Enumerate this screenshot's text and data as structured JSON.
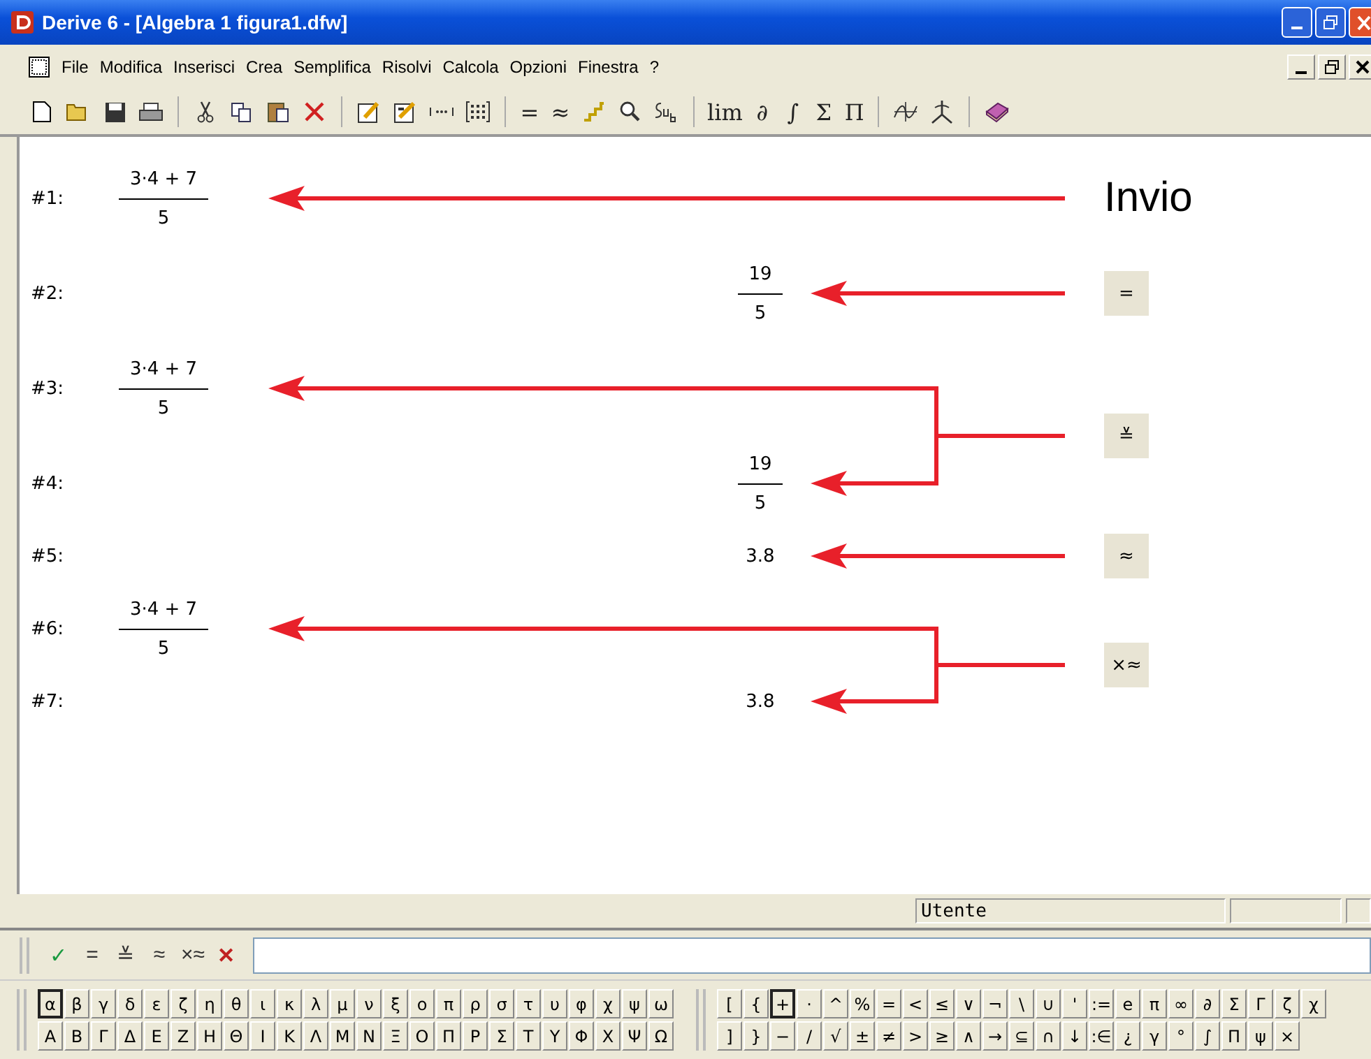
{
  "window": {
    "title": "Derive 6 - [Algebra 1  figura1.dfw]"
  },
  "menu": [
    "File",
    "Modifica",
    "Inserisci",
    "Crea",
    "Semplifica",
    "Risolvi",
    "Calcola",
    "Opzioni",
    "Finestra",
    "?"
  ],
  "toolbar": [
    [
      {
        "kind": "new"
      },
      {
        "kind": "open"
      },
      {
        "kind": "save"
      },
      {
        "kind": "print"
      }
    ],
    [
      {
        "kind": "cut"
      },
      {
        "kind": "copy"
      },
      {
        "kind": "paste"
      },
      {
        "kind": "delete"
      }
    ],
    [
      {
        "kind": "author"
      },
      {
        "kind": "edit"
      },
      {
        "kind": "vector"
      },
      {
        "kind": "matrix"
      }
    ],
    [
      {
        "kind": "symbol",
        "text": "="
      },
      {
        "kind": "symbol",
        "text": "≈"
      },
      {
        "kind": "steps"
      },
      {
        "kind": "zoom"
      },
      {
        "kind": "sub"
      }
    ],
    [
      {
        "kind": "symbol",
        "text": "lim"
      },
      {
        "kind": "symbol",
        "text": "∂"
      },
      {
        "kind": "symbol",
        "text": "∫"
      },
      {
        "kind": "symbol",
        "text": "Σ"
      },
      {
        "kind": "symbol",
        "text": "Π"
      }
    ],
    [
      {
        "kind": "plot2d"
      },
      {
        "kind": "plot3d"
      }
    ],
    [
      {
        "kind": "book"
      }
    ]
  ],
  "steps": [
    {
      "key": {
        "kind": "text",
        "label": "Invio"
      },
      "expressions": [
        {
          "label": "#1:",
          "kind": "input",
          "numerator": "3·4 + 7",
          "denominator": "5"
        }
      ]
    },
    {
      "key": {
        "kind": "key",
        "label": "="
      },
      "expressions": [
        {
          "label": "#2:",
          "kind": "result",
          "numerator": "19",
          "denominator": "5"
        }
      ]
    },
    {
      "key": {
        "kind": "key",
        "label": "≚"
      },
      "expressions": [
        {
          "label": "#3:",
          "kind": "input",
          "numerator": "3·4 + 7",
          "denominator": "5"
        },
        {
          "label": "#4:",
          "kind": "result",
          "numerator": "19",
          "denominator": "5"
        }
      ]
    },
    {
      "key": {
        "kind": "key",
        "label": "≈"
      },
      "expressions": [
        {
          "label": "#5:",
          "kind": "result",
          "value": "3.8"
        }
      ]
    },
    {
      "key": {
        "kind": "key",
        "label": "×≈"
      },
      "expressions": [
        {
          "label": "#6:",
          "kind": "input",
          "numerator": "3·4 + 7",
          "denominator": "5"
        },
        {
          "label": "#7:",
          "kind": "result",
          "value": "3.8"
        }
      ]
    }
  ],
  "status_bar": {
    "mode": "Utente"
  },
  "entry_bar": {
    "buttons": [
      {
        "text": "✓",
        "kind": "accept"
      },
      {
        "text": "=",
        "kind": "plain"
      },
      {
        "text": "≚",
        "kind": "plain"
      },
      {
        "text": "≈",
        "kind": "plain"
      },
      {
        "text": "×≈",
        "kind": "plain"
      },
      {
        "text": "✕",
        "kind": "cancel"
      }
    ]
  },
  "greek_palette": [
    [
      {
        "text": "α",
        "selected": true
      },
      {
        "text": "β",
        "selected": false
      },
      {
        "text": "γ",
        "selected": false
      },
      {
        "text": "δ",
        "selected": false
      },
      {
        "text": "ε",
        "selected": false
      },
      {
        "text": "ζ",
        "selected": false
      },
      {
        "text": "η",
        "selected": false
      },
      {
        "text": "θ",
        "selected": false
      },
      {
        "text": "ι",
        "selected": false
      },
      {
        "text": "κ",
        "selected": false
      },
      {
        "text": "λ",
        "selected": false
      },
      {
        "text": "μ",
        "selected": false
      },
      {
        "text": "ν",
        "selected": false
      },
      {
        "text": "ξ",
        "selected": false
      },
      {
        "text": "ο",
        "selected": false
      },
      {
        "text": "π",
        "selected": false
      },
      {
        "text": "ρ",
        "selected": false
      },
      {
        "text": "σ",
        "selected": false
      },
      {
        "text": "τ",
        "selected": false
      },
      {
        "text": "υ",
        "selected": false
      },
      {
        "text": "φ",
        "selected": false
      },
      {
        "text": "χ",
        "selected": false
      },
      {
        "text": "ψ",
        "selected": false
      },
      {
        "text": "ω",
        "selected": false
      }
    ],
    [
      {
        "text": "Α",
        "selected": false
      },
      {
        "text": "Β",
        "selected": false
      },
      {
        "text": "Γ",
        "selected": false
      },
      {
        "text": "Δ",
        "selected": false
      },
      {
        "text": "Ε",
        "selected": false
      },
      {
        "text": "Ζ",
        "selected": false
      },
      {
        "text": "Η",
        "selected": false
      },
      {
        "text": "Θ",
        "selected": false
      },
      {
        "text": "Ι",
        "selected": false
      },
      {
        "text": "Κ",
        "selected": false
      },
      {
        "text": "Λ",
        "selected": false
      },
      {
        "text": "Μ",
        "selected": false
      },
      {
        "text": "Ν",
        "selected": false
      },
      {
        "text": "Ξ",
        "selected": false
      },
      {
        "text": "Ο",
        "selected": false
      },
      {
        "text": "Π",
        "selected": false
      },
      {
        "text": "Ρ",
        "selected": false
      },
      {
        "text": "Σ",
        "selected": false
      },
      {
        "text": "Τ",
        "selected": false
      },
      {
        "text": "Υ",
        "selected": false
      },
      {
        "text": "Φ",
        "selected": false
      },
      {
        "text": "Χ",
        "selected": false
      },
      {
        "text": "Ψ",
        "selected": false
      },
      {
        "text": "Ω",
        "selected": false
      }
    ]
  ],
  "symbol_palette": [
    [
      {
        "text": "[",
        "selected": false
      },
      {
        "text": "{",
        "selected": false
      },
      {
        "text": "+",
        "selected": true
      },
      {
        "text": "·",
        "selected": false
      },
      {
        "text": "^",
        "selected": false
      },
      {
        "text": "%",
        "selected": false
      },
      {
        "text": "=",
        "selected": false
      },
      {
        "text": "<",
        "selected": false
      },
      {
        "text": "≤",
        "selected": false
      },
      {
        "text": "∨",
        "selected": false
      },
      {
        "text": "¬",
        "selected": false
      },
      {
        "text": "\\",
        "selected": false
      },
      {
        "text": "∪",
        "selected": false
      },
      {
        "text": "'",
        "selected": false
      },
      {
        "text": ":=",
        "selected": false
      },
      {
        "text": "e",
        "selected": false
      },
      {
        "text": "π",
        "selected": false
      },
      {
        "text": "∞",
        "selected": false
      },
      {
        "text": "∂",
        "selected": false
      },
      {
        "text": "Σ",
        "selected": false
      },
      {
        "text": "Γ",
        "selected": false
      },
      {
        "text": "ζ",
        "selected": false
      },
      {
        "text": "χ",
        "selected": false
      }
    ],
    [
      {
        "text": "]",
        "selected": false
      },
      {
        "text": "}",
        "selected": false
      },
      {
        "text": "−",
        "selected": false
      },
      {
        "text": "/",
        "selected": false
      },
      {
        "text": "√",
        "selected": false
      },
      {
        "text": "±",
        "selected": false
      },
      {
        "text": "≠",
        "selected": false
      },
      {
        "text": ">",
        "selected": false
      },
      {
        "text": "≥",
        "selected": false
      },
      {
        "text": "∧",
        "selected": false
      },
      {
        "text": "→",
        "selected": false
      },
      {
        "text": "⊆",
        "selected": false
      },
      {
        "text": "∩",
        "selected": false
      },
      {
        "text": "↓",
        "selected": false
      },
      {
        "text": ":∈",
        "selected": false
      },
      {
        "text": "¿",
        "selected": false
      },
      {
        "text": "γ",
        "selected": false
      },
      {
        "text": "°",
        "selected": false
      },
      {
        "text": "∫",
        "selected": false
      },
      {
        "text": "Π",
        "selected": false
      },
      {
        "text": "ψ",
        "selected": false
      },
      {
        "text": "×",
        "selected": false
      }
    ]
  ]
}
